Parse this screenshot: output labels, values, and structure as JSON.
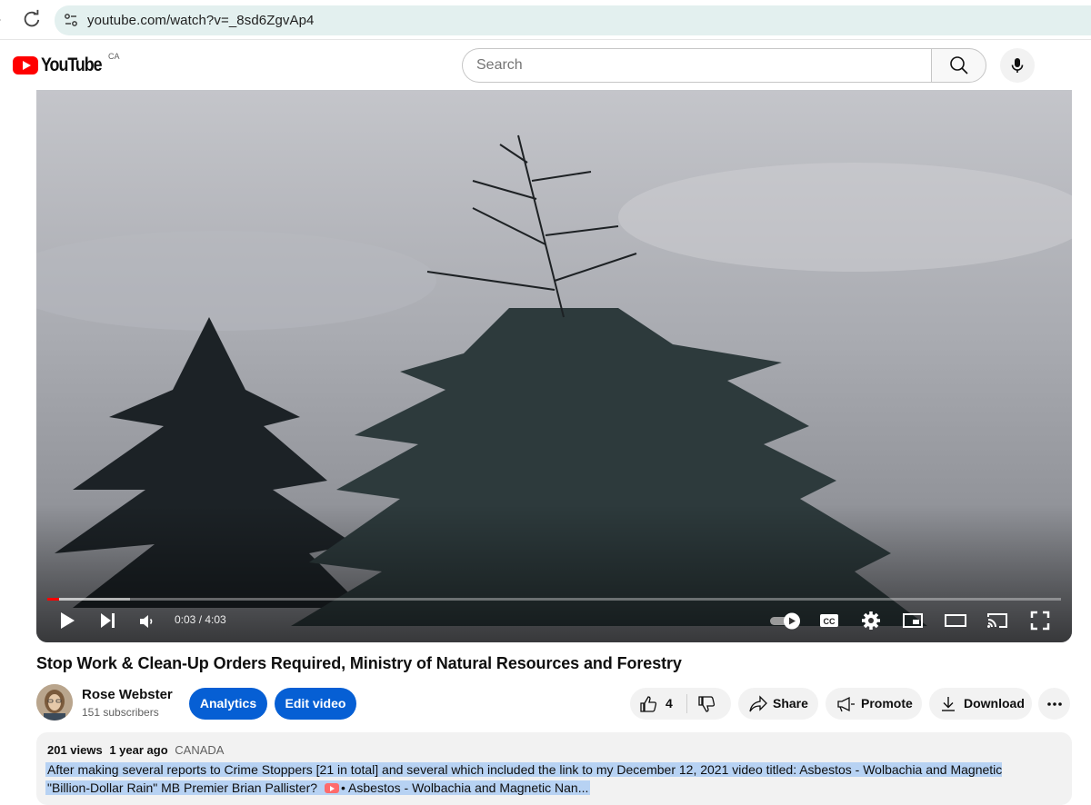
{
  "browser": {
    "url": "youtube.com/watch?v=_8sd6ZgvAp4"
  },
  "header": {
    "logo_text": "YouTube",
    "country_code": "CA",
    "search_placeholder": "Search"
  },
  "player": {
    "current_time": "0:03",
    "duration": "4:03",
    "time_display": "0:03 / 4:03",
    "progress_fraction": 0.012,
    "buffered_fraction": 0.082,
    "accent_color": "#ff0000",
    "controls": [
      "play-icon",
      "next-icon",
      "volume-icon",
      "autoplay-toggle",
      "cc-icon",
      "settings-icon",
      "miniplayer-icon",
      "theater-icon",
      "cast-icon",
      "fullscreen-icon"
    ]
  },
  "video": {
    "title": "Stop Work & Clean-Up Orders Required, Ministry of Natural Resources and Forestry"
  },
  "channel": {
    "name": "Rose Webster",
    "subscribers": "151 subscribers"
  },
  "actions": {
    "analytics_label": "Analytics",
    "edit_label": "Edit video",
    "like_count": "4",
    "share_label": "Share",
    "promote_label": "Promote",
    "download_label": "Download",
    "primary_color": "#065fd4"
  },
  "description": {
    "views": "201 views",
    "age": "1 year ago",
    "country": "CANADA",
    "line1": "After making several reports to Crime Stoppers [21 in total] and several which included the link to my December 12, 2021 video titled: Asbestos - Wolbachia and Magnetic Nanoparticles?",
    "line2_text": "\"Billion-Dollar Rain\" MB Premier Brian Pallister?",
    "line2_link": "• Asbestos - Wolbachia and Magnetic Nan..."
  }
}
